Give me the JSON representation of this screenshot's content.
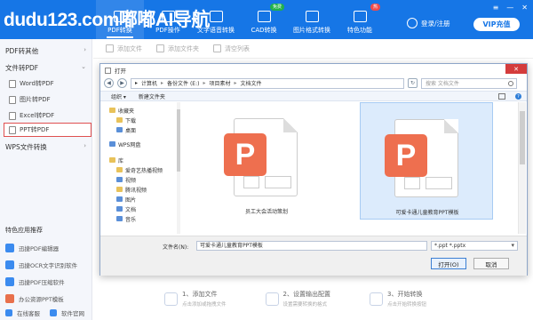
{
  "brand": "dudu123.com嘟嘟AI导航",
  "nav": [
    {
      "label": "PDF转换",
      "icon": "pdf-convert-icon"
    },
    {
      "label": "PDF操作",
      "icon": "pdf-operate-icon"
    },
    {
      "label": "文字语音转换",
      "icon": "speech-icon"
    },
    {
      "label": "CAD转换",
      "icon": "cad-icon",
      "badge": "免费"
    },
    {
      "label": "图片格式转换",
      "icon": "image-icon"
    },
    {
      "label": "特色功能",
      "icon": "gift-icon",
      "badge": "热"
    }
  ],
  "user": {
    "text": "登录/注册"
  },
  "vip": "VIP充值",
  "window_controls": [
    "≡",
    "—",
    "✕"
  ],
  "sidebar": {
    "section1": "PDF转其他",
    "section2": "文件转PDF",
    "items": [
      {
        "label": "Word转PDF"
      },
      {
        "label": "图片转PDF"
      },
      {
        "label": "Excel转PDF"
      },
      {
        "label": "PPT转PDF"
      }
    ],
    "section3": "WPS文件转换",
    "recommend_title": "特色应用推荐",
    "recommend": [
      {
        "label": "迅捷PDF编辑器"
      },
      {
        "label": "迅捷OCR文字识别软件"
      },
      {
        "label": "迅捷PDF压缩软件"
      },
      {
        "label": "办公资源PPT模板"
      },
      {
        "label": "在线客服"
      },
      {
        "label": "软件官网"
      }
    ]
  },
  "toolbar": {
    "add_file": "添加文件",
    "add_folder": "添加文件夹",
    "clear_list": "清空列表"
  },
  "steps": [
    {
      "title": "1、添加文件",
      "sub": "点击添加或拖拽文件"
    },
    {
      "title": "2、设置输出配置",
      "sub": "设置需要转换的格式"
    },
    {
      "title": "3、开始转换",
      "sub": "点击开始转换按钮"
    }
  ],
  "dialog": {
    "title": "打开",
    "close": "✕",
    "crumbs": [
      "计算机",
      "备份文件 (E:)",
      "项目素材",
      "文档文件"
    ],
    "search_placeholder": "搜索 文档文件",
    "organize": "组织 ▾",
    "new_folder": "新建文件夹",
    "help": "?",
    "tree": [
      {
        "label": "收藏夹",
        "level": 0,
        "icon": "star"
      },
      {
        "label": "下载",
        "level": 1,
        "icon": "folder"
      },
      {
        "label": "桌面",
        "level": 1,
        "icon": "folder"
      },
      {
        "label": "WPS网盘",
        "level": 0,
        "icon": "cloud"
      },
      {
        "label": "库",
        "level": 0,
        "icon": "library"
      },
      {
        "label": "爱奇艺热播视频",
        "level": 1,
        "icon": "folder"
      },
      {
        "label": "视频",
        "level": 1,
        "icon": "folder"
      },
      {
        "label": "腾讯视频",
        "level": 1,
        "icon": "folder"
      },
      {
        "label": "图片",
        "level": 1,
        "icon": "folder"
      },
      {
        "label": "文档",
        "level": 1,
        "icon": "folder"
      },
      {
        "label": "音乐",
        "level": 1,
        "icon": "folder"
      }
    ],
    "files": [
      {
        "name": "员工大会活动策划",
        "selected": false
      },
      {
        "name": "可爱卡通儿童教育PPT模板",
        "selected": true
      }
    ],
    "ppt_letter": "P",
    "filename_label": "文件名(N):",
    "filename_value": "可爱卡通儿童教育PPT模板",
    "filetype": "*.ppt *.pptx",
    "open_button": "打开(O)",
    "cancel_button": "取消"
  },
  "colors": {
    "accent": "#1676e6",
    "ppt": "#ee6f4f",
    "selected_border": "#e05050"
  }
}
